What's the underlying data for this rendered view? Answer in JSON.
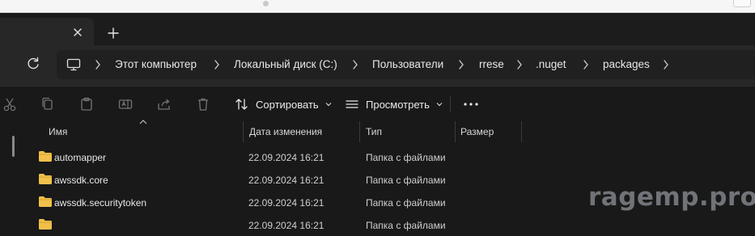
{
  "tabbar": {
    "close_icon": "close-icon",
    "new_tab_icon": "plus-icon"
  },
  "address": {
    "refresh_icon": "refresh-icon",
    "computer_icon": "computer-icon",
    "crumbs": [
      "Этот компьютер",
      "Локальный диск (C:)",
      "Пользователи",
      "rrese",
      ".nuget",
      "packages"
    ]
  },
  "toolbar": {
    "sort_label": "Сортировать",
    "view_label": "Просмотреть",
    "more_label": "•••",
    "tool_icons": [
      "cut-icon",
      "copy-icon",
      "paste-icon",
      "rename-icon",
      "share-icon",
      "delete-icon"
    ]
  },
  "list": {
    "columns": {
      "name": "Имя",
      "date": "Дата изменения",
      "type": "Тип",
      "size": "Размер"
    },
    "rows": [
      {
        "name": "automapper",
        "date": "22.09.2024 16:21",
        "type": "Папка с файлами"
      },
      {
        "name": "awssdk.core",
        "date": "22.09.2024 16:21",
        "type": "Папка с файлами"
      },
      {
        "name": "awssdk.securitytoken",
        "date": "22.09.2024 16:21",
        "type": "Папка с файлами"
      },
      {
        "name": "",
        "date": "22.09.2024 16:21",
        "type": "Папка с файлами"
      }
    ]
  },
  "watermark": "ragemp.pro",
  "colors": {
    "background": "#191919",
    "address_bar": "#272727",
    "folder": "#f0c04a"
  }
}
